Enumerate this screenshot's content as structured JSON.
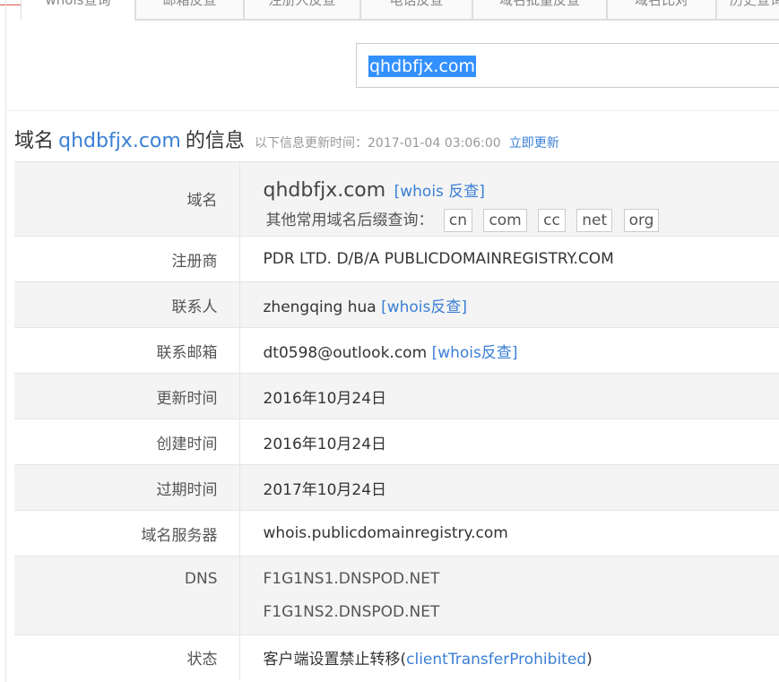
{
  "tabs": [
    "whois查询",
    "邮箱反查",
    "注册人反查",
    "电话反查",
    "域名批量反查",
    "域名比对",
    "历史查询"
  ],
  "search": {
    "query": "qhdbfjx.com"
  },
  "heading": {
    "prefix": "域名",
    "domain": "qhdbfjx.com",
    "suffix": "的信息",
    "update_info": "以下信息更新时间：2017-01-04 03:06:00",
    "update_link": "立即更新"
  },
  "rows": {
    "domain": {
      "label": "域名",
      "value": "qhdbfjx.com",
      "link": "[whois 反查]",
      "suffix_prompt": "其他常用域名后缀查询：",
      "suffixes": [
        "cn",
        "com",
        "cc",
        "net",
        "org"
      ]
    },
    "registrar": {
      "label": "注册商",
      "value": "PDR LTD. D/B/A PUBLICDOMAINREGISTRY.COM"
    },
    "contact": {
      "label": "联系人",
      "value": "zhengqing hua",
      "link": "[whois反查]"
    },
    "email": {
      "label": "联系邮箱",
      "value": "dt0598@outlook.com",
      "link": "[whois反查]"
    },
    "updated": {
      "label": "更新时间",
      "value": "2016年10月24日"
    },
    "created": {
      "label": "创建时间",
      "value": "2016年10月24日"
    },
    "expires": {
      "label": "过期时间",
      "value": "2017年10月24日"
    },
    "whois_server": {
      "label": "域名服务器",
      "value": "whois.publicdomainregistry.com"
    },
    "dns": {
      "label": "DNS",
      "values": [
        "F1G1NS1.DNSPOD.NET",
        "F1G1NS2.DNSPOD.NET"
      ]
    },
    "status": {
      "label": "状态",
      "prefix": "客户端设置禁止转移(",
      "link": "clientTransferProhibited",
      "suffix": ")"
    }
  }
}
